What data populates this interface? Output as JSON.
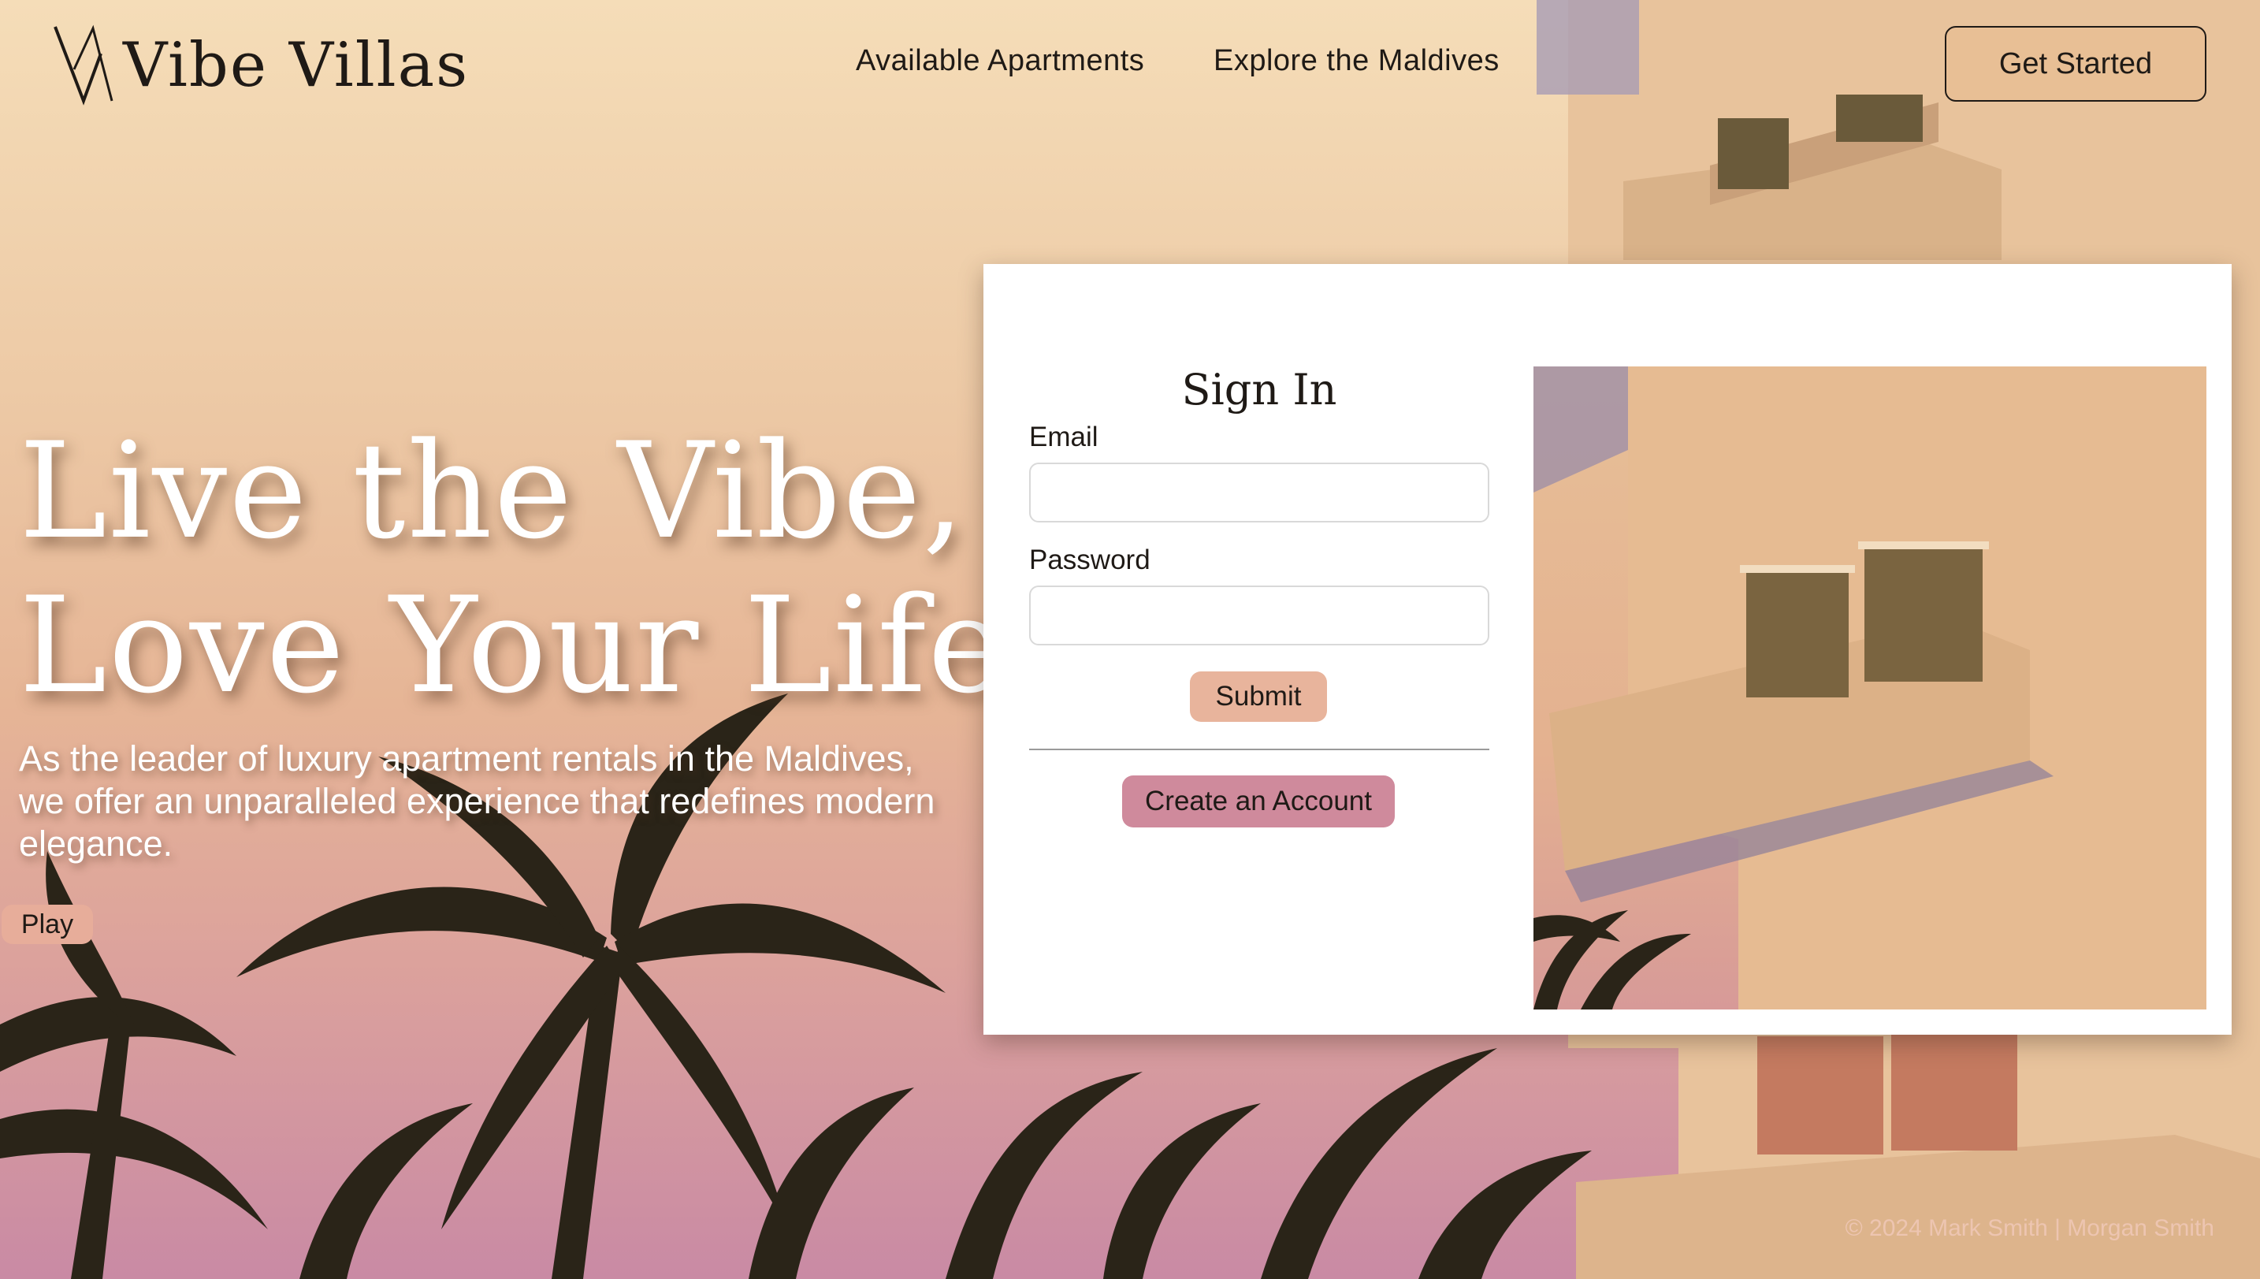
{
  "brand": {
    "name": "Vibe Villas"
  },
  "nav": {
    "links": [
      "Available Apartments",
      "Explore the Maldives"
    ],
    "cta": "Get Started"
  },
  "hero": {
    "title_line1": "Live the Vibe,",
    "title_line2": "Love Your Life",
    "subtitle": "As the leader of luxury apartment rentals in the Maldives, we offer an unparalleled experience that redefines modern elegance.",
    "play_label": "Play"
  },
  "signin": {
    "title": "Sign In",
    "email_label": "Email",
    "email_value": "",
    "password_label": "Password",
    "password_value": "",
    "submit_label": "Submit",
    "create_label": "Create an Account"
  },
  "footer": {
    "text": "© 2024 Mark Smith | Morgan Smith"
  },
  "colors": {
    "accent_peach": "#e8b49c",
    "accent_rose": "#cf8a9c",
    "cta_bg": "#e8bf95"
  }
}
